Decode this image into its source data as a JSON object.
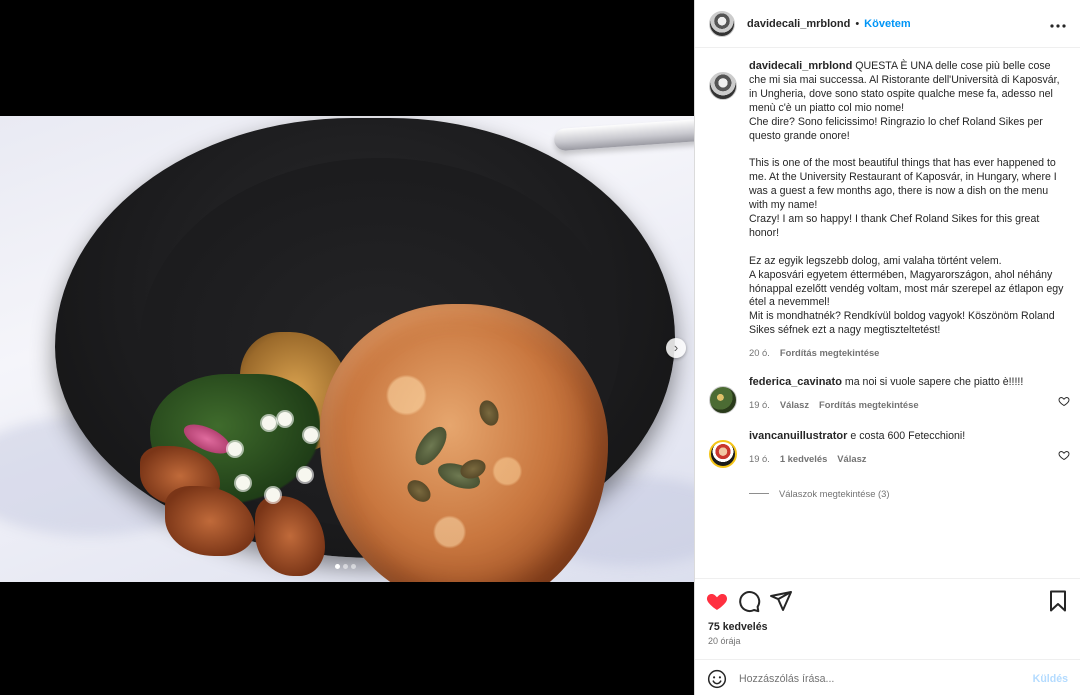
{
  "post": {
    "author": "davidecali_mrblond",
    "follow_label": "Követem",
    "separator": "•",
    "more_label": "•••",
    "caption_author": "davidecali_mrblond",
    "caption_text": "QUESTA È UNA delle cose più belle cose che mi sia mai successa. Al Ristorante dell'Università di Kaposvár, in Ungheria, dove sono stato ospite qualche mese fa, adesso nel menù c'è un piatto col mio nome!\nChe dire? Sono felicissimo! Ringrazio lo chef Roland Sikes per questo grande onore!\n\nThis is one of the most beautiful things that has ever happened to me. At the University Restaurant of Kaposvár, in Hungary, where I was a guest a few months ago, there is now a dish on the menu with my name!\nCrazy! I am so happy! I thank Chef Roland Sikes for this great honor!\n\nEz az egyik legszebb dolog, ami valaha történt velem.\nA kaposvári egyetem éttermében, Magyarországon, ahol néhány hónappal ezelőtt vendég voltam, most már szerepel az étlapon egy étel a nevemmel!\nMit is mondhatnék? Rendkívül boldog vagyok! Köszönöm Roland Sikes séfnek ezt a nagy megtiszteltetést!",
    "caption_time": "20 ó.",
    "caption_translate": "Fordítás megtekintése"
  },
  "comments": [
    {
      "user": "federica_cavinato",
      "text": "ma noi si vuole sapere che piatto è!!!!!",
      "time": "19 ó.",
      "reply": "Válasz",
      "translate": "Fordítás megtekintése"
    },
    {
      "user": "ivancanuillustrator",
      "text": "e costa 600 Fetecchioni!",
      "time": "19 ó.",
      "likes": "1 kedvelés",
      "reply": "Válasz"
    }
  ],
  "replies_toggle": "Válaszok megtekintése (3)",
  "stats": {
    "likes": "75 kedvelés",
    "posted": "20 órája"
  },
  "composer": {
    "placeholder": "Hozzászólás írása...",
    "send_label": "Küldés"
  },
  "carousel": {
    "next": "›",
    "total_slides": 3,
    "active_slide": 1
  },
  "colors": {
    "accent": "#0095f6",
    "liked_heart": "#ff3040",
    "send_disabled": "#b3dbff"
  },
  "icons": {
    "like": "heart-icon-filled",
    "comment": "comment-icon",
    "share": "send-icon",
    "save": "bookmark-icon",
    "emoji": "smile-icon",
    "comment_like": "heart-outline-icon"
  }
}
